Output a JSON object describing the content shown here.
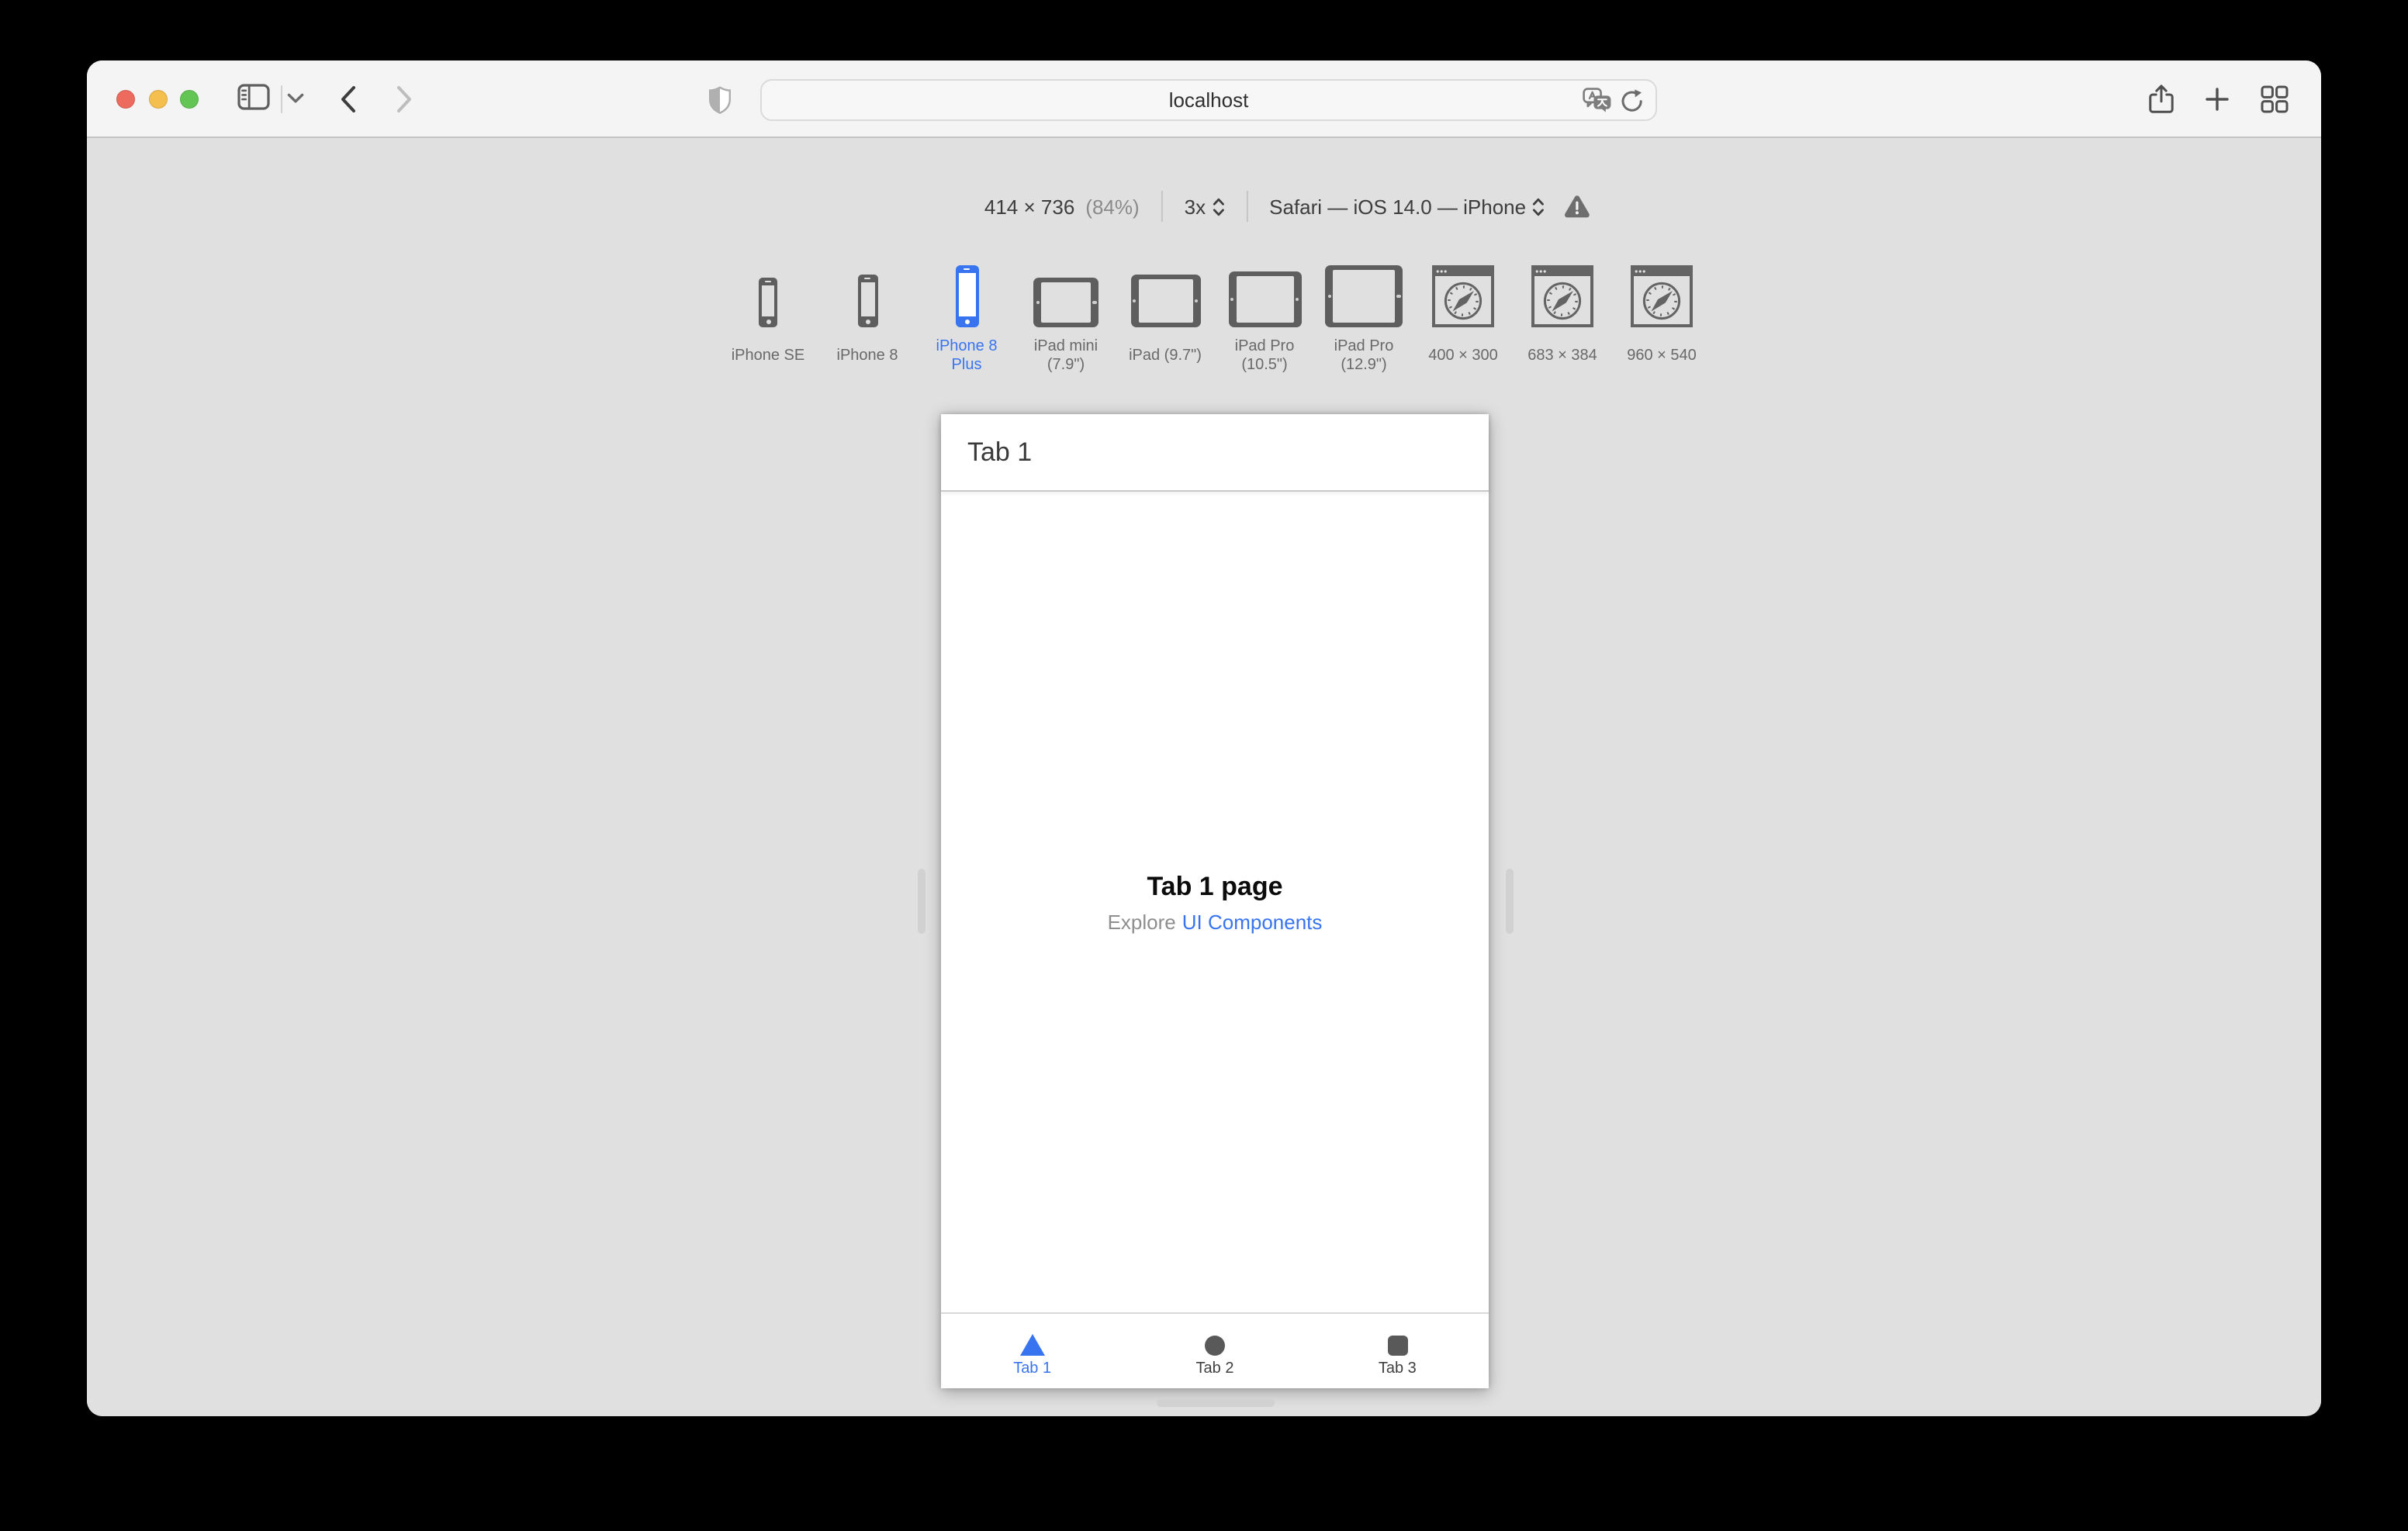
{
  "colors": {
    "accent": "#3874f0",
    "toolbar_bg": "#f4f4f4",
    "canvas_bg": "#e0e0e0",
    "icon_gray": "#5e5e5e",
    "tab_inactive": "#595959"
  },
  "address_bar": {
    "value": "localhost"
  },
  "status": {
    "size": "414 × 736",
    "zoom": "(84%)",
    "scale": "3x",
    "browser": "Safari — iOS 14.0 — iPhone"
  },
  "rdm": {
    "devices": [
      {
        "label": "iPhone SE",
        "selected": false
      },
      {
        "label": "iPhone 8",
        "selected": false
      },
      {
        "label": "iPhone 8 Plus",
        "selected": true
      },
      {
        "label": "iPad mini (7.9\")",
        "selected": false
      },
      {
        "label": "iPad (9.7\")",
        "selected": false
      },
      {
        "label": "iPad Pro (10.5\")",
        "selected": false
      },
      {
        "label": "iPad Pro (12.9\")",
        "selected": false
      },
      {
        "label": "400 × 300",
        "selected": false
      },
      {
        "label": "683 × 384",
        "selected": false
      },
      {
        "label": "960 × 540",
        "selected": false
      }
    ]
  },
  "viewport": {
    "nav_title": "Tab 1",
    "heading": "Tab 1 page",
    "explore": "Explore",
    "link_label": "UI Components",
    "tabs": [
      {
        "label": "Tab 1",
        "active": true
      },
      {
        "label": "Tab 2",
        "active": false
      },
      {
        "label": "Tab 3",
        "active": false
      }
    ]
  }
}
